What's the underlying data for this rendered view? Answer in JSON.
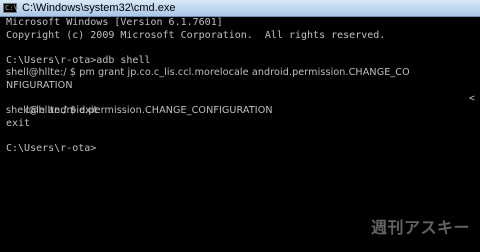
{
  "window": {
    "title": "C:\\Windows\\system32\\cmd.exe",
    "icon_text": "C:\\"
  },
  "console": {
    "lines": [
      "Microsoft Windows [Version 6.1.7601]",
      "Copyright (c) 2009 Microsoft Corporation.  All rights reserved.",
      "",
      "C:\\Users\\r-ota>adb shell",
      "shell@hllte:/ $ pm grant jp.co.c_lis.ccl.morelocale android.permission.CHANGE_CO",
      "NFIGURATION",
      "cale android.permission.CHANGE_CONFIGURATION",
      "shell@hllte:/ $ exit",
      "exit",
      "",
      "C:\\Users\\r-ota>"
    ],
    "scroll_indicator": "<"
  },
  "watermark": {
    "text": "週刊アスキー"
  },
  "colors": {
    "console_bg": "#000000",
    "console_fg": "#c0c0c0",
    "titlebar": "#bcd4ee"
  }
}
